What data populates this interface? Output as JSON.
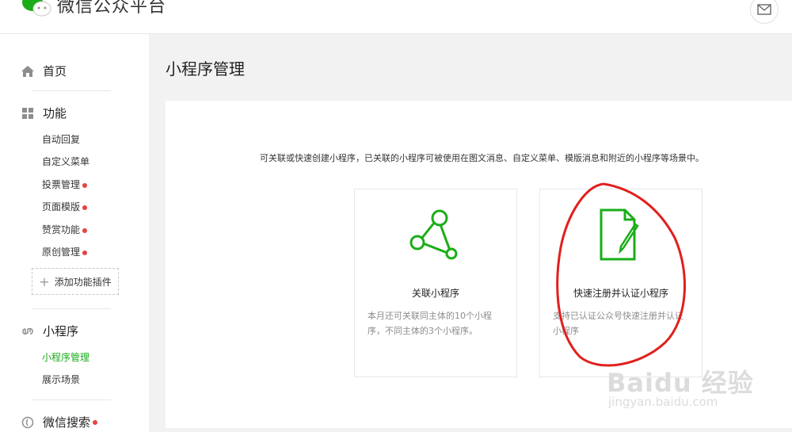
{
  "header": {
    "brand": "微信公众平台"
  },
  "sidebar": {
    "home": "首页",
    "features": {
      "title": "功能",
      "items": [
        {
          "label": "自动回复",
          "dot": false
        },
        {
          "label": "自定义菜单",
          "dot": false
        },
        {
          "label": "投票管理",
          "dot": true
        },
        {
          "label": "页面模版",
          "dot": true
        },
        {
          "label": "赞赏功能",
          "dot": true
        },
        {
          "label": "原创管理",
          "dot": true
        }
      ],
      "add_plugin": "添加功能插件"
    },
    "miniprogram": {
      "title": "小程序",
      "items": [
        {
          "label": "小程序管理",
          "active": true
        },
        {
          "label": "展示场景",
          "active": false
        }
      ]
    },
    "search": {
      "title": "微信搜索"
    }
  },
  "main": {
    "title": "小程序管理",
    "intro": "可关联或快速创建小程序，已关联的小程序可被使用在图文消息、自定义菜单、模版消息和附近的小程序等场景中。",
    "cards": [
      {
        "title": "关联小程序",
        "desc": "本月还可关联同主体的10个小程序，不同主体的3个小程序。",
        "icon": "link-nodes-icon"
      },
      {
        "title": "快速注册并认证小程序",
        "desc": "支持已认证公众号快速注册并认证小程序",
        "icon": "document-edit-icon"
      }
    ]
  },
  "watermark": {
    "main": "Baidu 经验",
    "sub": "jingyan.baidu.com"
  },
  "colors": {
    "accent": "#1aad19",
    "dot": "#e64340",
    "annotation": "#e0201c"
  }
}
